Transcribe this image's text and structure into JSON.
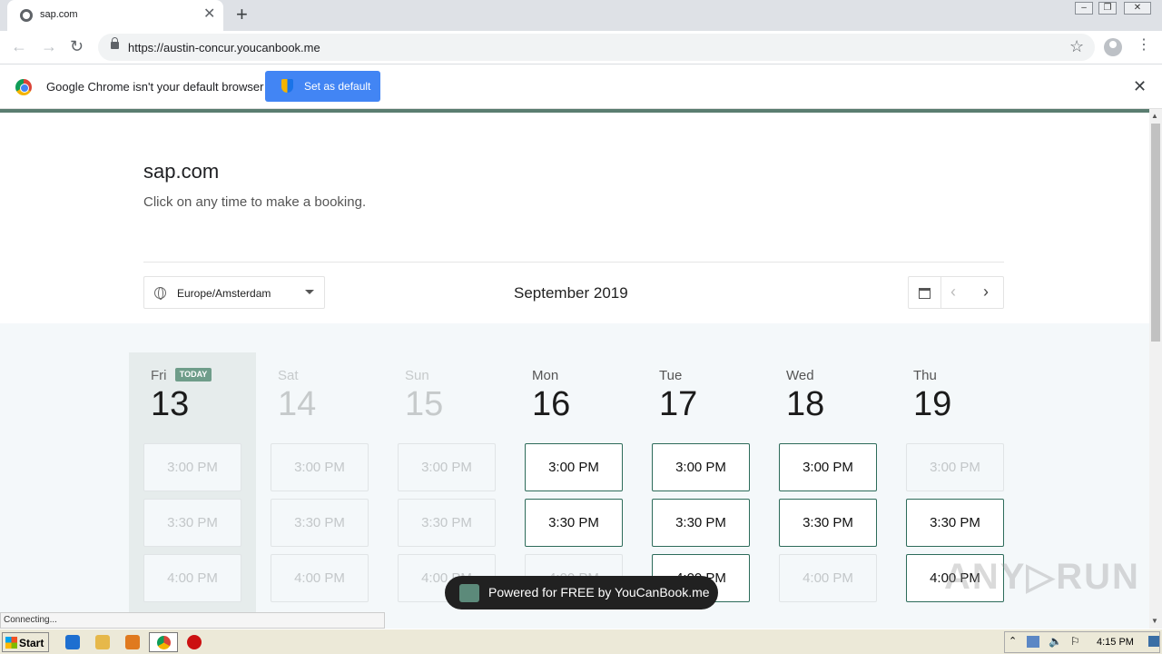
{
  "browser": {
    "tab_title": "sap.com",
    "url": "https://austin-concur.youcanbook.me",
    "infobar_text": "Google Chrome isn't your default browser",
    "set_default_label": "Set as default"
  },
  "page": {
    "title": "sap.com",
    "subtitle": "Click on any time to make a booking.",
    "timezone": "Europe/Amsterdam",
    "month": "September 2019",
    "today_badge": "TODAY",
    "days": [
      {
        "name": "Fri",
        "num": "13",
        "today": true,
        "slots": [
          {
            "time": "3:00 PM",
            "available": false
          },
          {
            "time": "3:30 PM",
            "available": false
          },
          {
            "time": "4:00 PM",
            "available": false
          }
        ]
      },
      {
        "name": "Sat",
        "num": "14",
        "today": false,
        "slots": [
          {
            "time": "3:00 PM",
            "available": false
          },
          {
            "time": "3:30 PM",
            "available": false
          },
          {
            "time": "4:00 PM",
            "available": false
          }
        ]
      },
      {
        "name": "Sun",
        "num": "15",
        "today": false,
        "slots": [
          {
            "time": "3:00 PM",
            "available": false
          },
          {
            "time": "3:30 PM",
            "available": false
          },
          {
            "time": "4:00 PM",
            "available": false
          }
        ]
      },
      {
        "name": "Mon",
        "num": "16",
        "today": false,
        "slots": [
          {
            "time": "3:00 PM",
            "available": true
          },
          {
            "time": "3:30 PM",
            "available": true
          },
          {
            "time": "4:00 PM",
            "available": false
          }
        ]
      },
      {
        "name": "Tue",
        "num": "17",
        "today": false,
        "slots": [
          {
            "time": "3:00 PM",
            "available": true
          },
          {
            "time": "3:30 PM",
            "available": true
          },
          {
            "time": "4:00 PM",
            "available": true
          }
        ]
      },
      {
        "name": "Wed",
        "num": "18",
        "today": false,
        "slots": [
          {
            "time": "3:00 PM",
            "available": true
          },
          {
            "time": "3:30 PM",
            "available": true
          },
          {
            "time": "4:00 PM",
            "available": false
          }
        ]
      },
      {
        "name": "Thu",
        "num": "19",
        "today": false,
        "slots": [
          {
            "time": "3:00 PM",
            "available": false
          },
          {
            "time": "3:30 PM",
            "available": true
          },
          {
            "time": "4:00 PM",
            "available": true
          }
        ]
      }
    ],
    "powered_by": "Powered for FREE by YouCanBook.me"
  },
  "status_text": "Connecting...",
  "taskbar": {
    "start_label": "Start",
    "clock": "4:15 PM"
  }
}
